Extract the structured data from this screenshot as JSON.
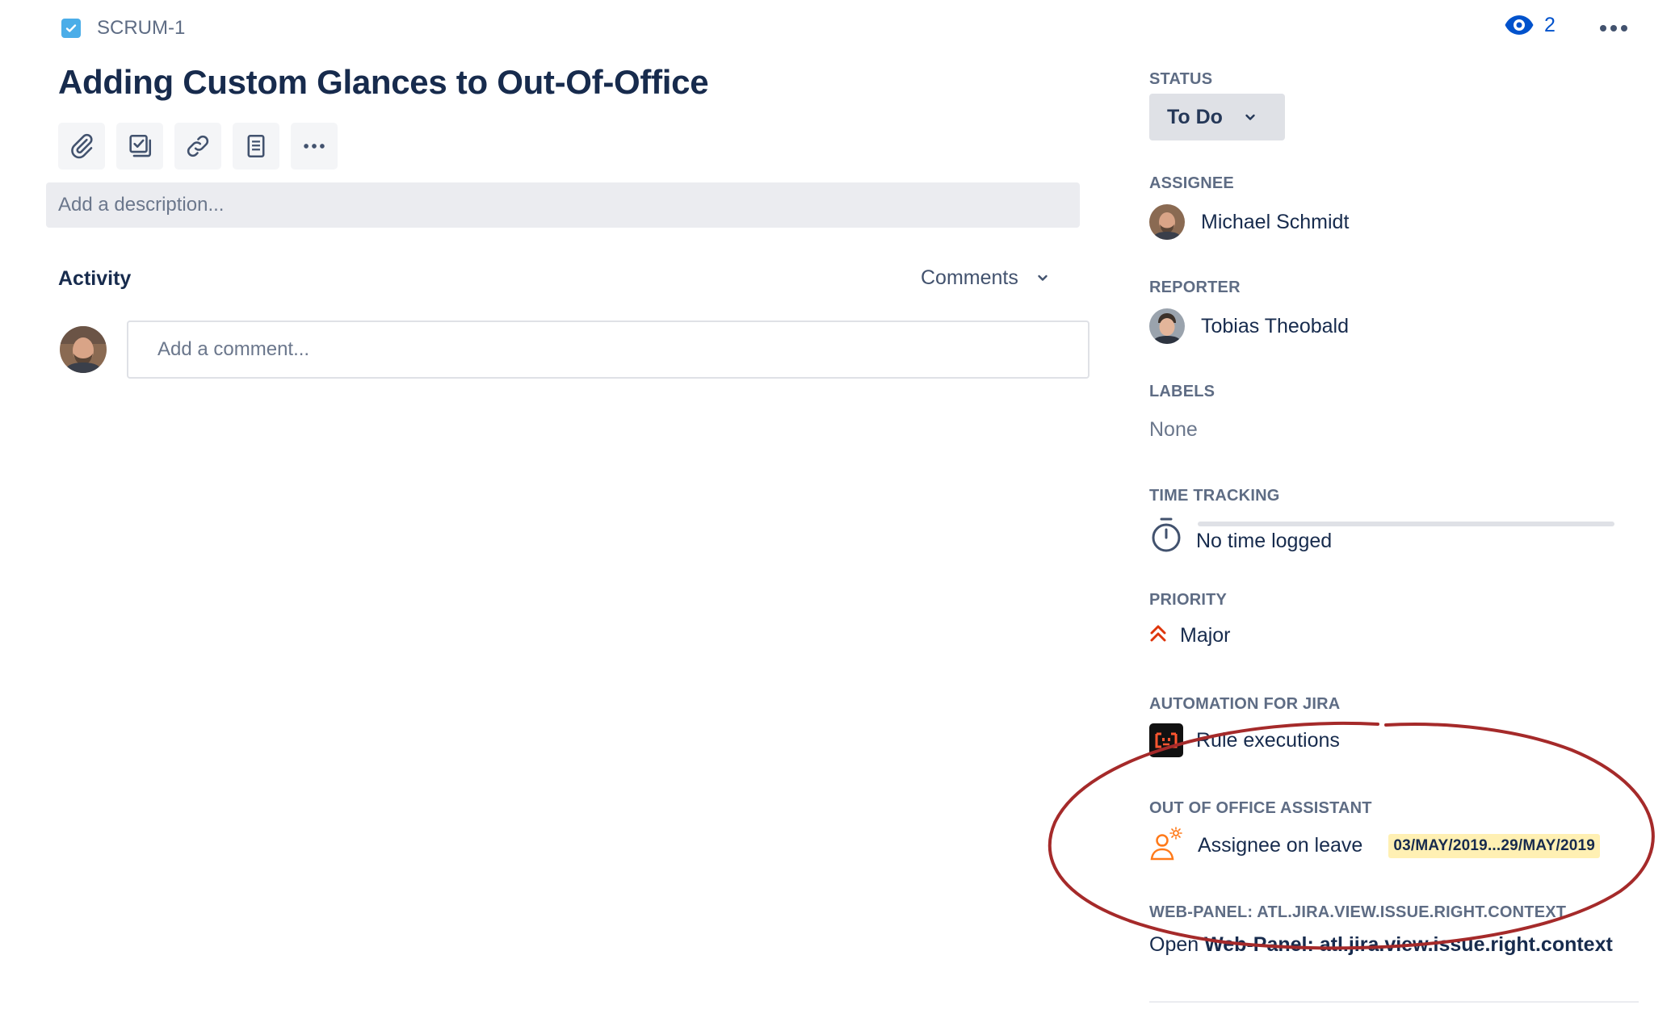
{
  "issue": {
    "key": "SCRUM-1",
    "title": "Adding Custom Glances to Out-Of-Office",
    "description_placeholder": "Add a description..."
  },
  "toolbar": {
    "icons": [
      "paperclip-icon",
      "subtask-checkbox-icon",
      "link-icon",
      "page-icon",
      "more-icon"
    ]
  },
  "activity": {
    "heading": "Activity",
    "filter_selected": "Comments",
    "comment_placeholder": "Add a comment..."
  },
  "header_actions": {
    "watchers_count": "2"
  },
  "sidebar": {
    "status": {
      "label": "STATUS",
      "value": "To Do"
    },
    "assignee": {
      "label": "ASSIGNEE",
      "value": "Michael Schmidt"
    },
    "reporter": {
      "label": "REPORTER",
      "value": "Tobias Theobald"
    },
    "labels": {
      "label": "LABELS",
      "value": "None"
    },
    "time_tracking": {
      "label": "TIME TRACKING",
      "value": "No time logged"
    },
    "priority": {
      "label": "PRIORITY",
      "value": "Major"
    },
    "automation": {
      "label": "AUTOMATION FOR JIRA",
      "value": "Rule executions"
    },
    "out_of_office": {
      "label": "OUT OF OFFICE ASSISTANT",
      "value": "Assignee on leave",
      "date_range": "03/MAY/2019...29/MAY/2019"
    },
    "web_panel": {
      "label": "WEB-PANEL: ATL.JIRA.VIEW.ISSUE.RIGHT.CONTEXT",
      "open_prefix": "Open",
      "open_link": "Web-Panel: atl.jira.view.issue.right.context"
    }
  },
  "colors": {
    "primary_text": "#172b4d",
    "secondary_text": "#5e6c84",
    "link_blue": "#0052cc",
    "issue_type_blue": "#4bade8",
    "priority_red": "#de350b",
    "badge_yellow": "#fff0b3",
    "annotation_red": "#a52a2a"
  }
}
